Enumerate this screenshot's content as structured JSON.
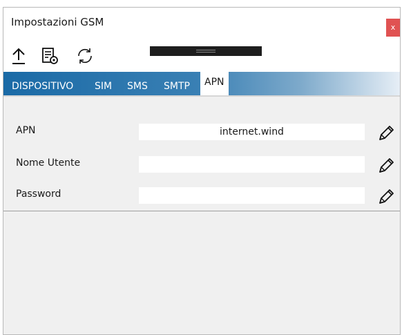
{
  "window": {
    "title": "Impostazioni GSM",
    "close_label": "x"
  },
  "toolbar": {
    "buttons": [
      {
        "icon": "upload-icon"
      },
      {
        "icon": "settings-document-icon"
      },
      {
        "icon": "refresh-icon"
      }
    ]
  },
  "tabs": [
    {
      "label": "DISPOSITIVO",
      "active": false
    },
    {
      "label": "SIM",
      "active": false
    },
    {
      "label": "SMS",
      "active": false
    },
    {
      "label": "SMTP",
      "active": false
    },
    {
      "label": "APN",
      "active": true
    }
  ],
  "apn_form": {
    "fields": [
      {
        "label": "APN",
        "value": "internet.wind",
        "icon": "pencil-icon"
      },
      {
        "label": "Nome Utente",
        "value": "",
        "icon": "pencil-icon"
      },
      {
        "label": "Password",
        "value": "",
        "icon": "pencil-icon"
      }
    ]
  },
  "colors": {
    "tab_bar_start": "#1a6aa6",
    "tab_bar_end": "#e6eef6",
    "close_button": "#e05252",
    "window_background": "#f0f0f0"
  }
}
